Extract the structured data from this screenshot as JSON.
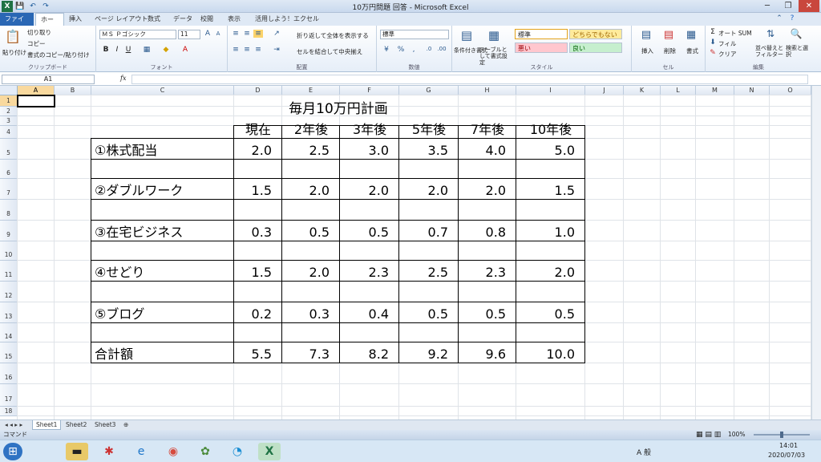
{
  "app": {
    "title": "10万円問題  回答 - Microsoft Excel",
    "file_tab": "ファイル",
    "tabs": [
      "ホーム",
      "挿入",
      "ページ レイアウト",
      "数式",
      "データ",
      "校閲",
      "表示",
      "活用しよう！エクセル"
    ]
  },
  "ribbon": {
    "clipboard": {
      "paste": "貼り付け",
      "cut": "切り取り",
      "copy": "コピー",
      "format_painter": "書式のコピー/貼り付け",
      "label": "クリップボード"
    },
    "font": {
      "name": "ＭＳ Ｐゴシック",
      "size": "11",
      "label": "フォント"
    },
    "alignment": {
      "wrap": "折り返して全体を表示する",
      "merge": "セルを結合して中央揃え",
      "label": "配置"
    },
    "number": {
      "format": "標準",
      "label": "数値"
    },
    "styles": {
      "cond": "条件付き書式",
      "table": "テーブルとして書式設定",
      "normal": "標準",
      "neutral": "どちらでもない",
      "bad": "悪い",
      "good": "良い",
      "label": "スタイル"
    },
    "cells": {
      "insert": "挿入",
      "delete": "削除",
      "format": "書式",
      "label": "セル"
    },
    "editing": {
      "autosum": "オート SUM",
      "fill": "フィル",
      "clear": "クリア",
      "sort": "並べ替えとフィルター",
      "find": "検索と選択",
      "label": "編集"
    }
  },
  "formula_bar": {
    "name_box": "A1",
    "fx": "fx",
    "value": ""
  },
  "columns": [
    "A",
    "B",
    "C",
    "D",
    "E",
    "F",
    "G",
    "H",
    "I",
    "J",
    "K",
    "L",
    "M",
    "N",
    "O"
  ],
  "rows": [
    "1",
    "2",
    "3",
    "4",
    "5",
    "6",
    "7",
    "8",
    "9",
    "10",
    "11",
    "12",
    "13",
    "14",
    "15",
    "16",
    "17",
    "18"
  ],
  "sheet": {
    "title": "毎月10万円計画",
    "headers": [
      "現在",
      "2年後",
      "3年後",
      "5年後",
      "7年後",
      "10年後"
    ],
    "table": [
      {
        "label": "①株式配当",
        "values": [
          "2.0",
          "2.5",
          "3.0",
          "3.5",
          "4.0",
          "5.0"
        ]
      },
      {
        "label": "②ダブルワーク",
        "values": [
          "1.5",
          "2.0",
          "2.0",
          "2.0",
          "2.0",
          "1.5"
        ]
      },
      {
        "label": "③在宅ビジネス",
        "values": [
          "0.3",
          "0.5",
          "0.5",
          "0.7",
          "0.8",
          "1.0"
        ]
      },
      {
        "label": "④せどり",
        "values": [
          "1.5",
          "2.0",
          "2.3",
          "2.5",
          "2.3",
          "2.0"
        ]
      },
      {
        "label": "⑤ブログ",
        "values": [
          "0.2",
          "0.3",
          "0.4",
          "0.5",
          "0.5",
          "0.5"
        ]
      },
      {
        "label": "合計額",
        "values": [
          "5.5",
          "7.3",
          "8.2",
          "9.2",
          "9.6",
          "10.0"
        ]
      }
    ]
  },
  "sheet_tabs": [
    "Sheet1",
    "Sheet2",
    "Sheet3"
  ],
  "status": {
    "mode": "コマンド",
    "zoom": "100%"
  },
  "taskbar": {
    "time": "14:01",
    "date": "2020/07/03",
    "ime": "A 般"
  }
}
